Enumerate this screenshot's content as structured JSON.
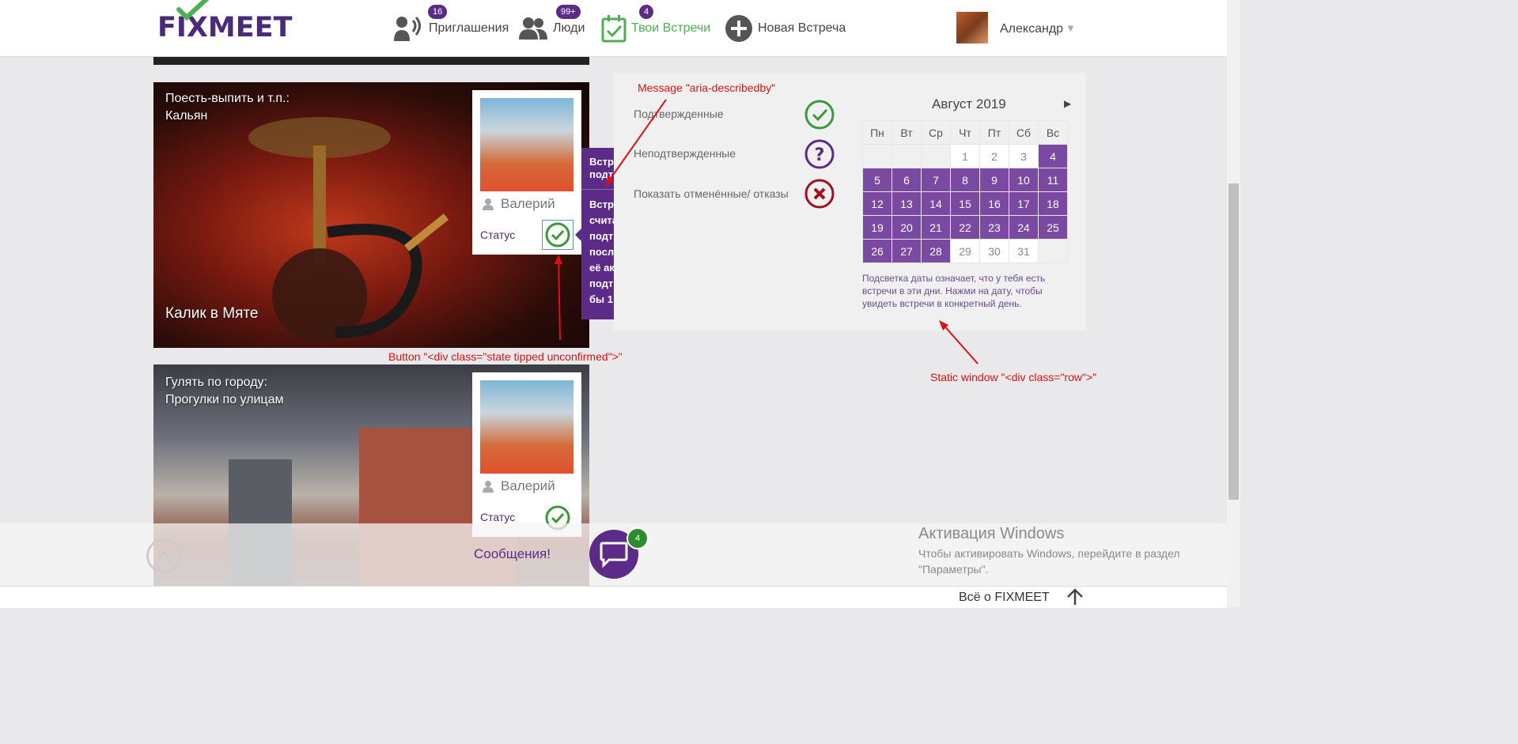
{
  "brand": {
    "logo": "FIXMEET",
    "accent": "#5b2b87"
  },
  "nav": {
    "invitations": {
      "label": "Приглашения",
      "badge": "16"
    },
    "people": {
      "label": "Люди",
      "badge": "99+"
    },
    "my_meetings": {
      "label": "Твои Встречи",
      "badge": "4"
    },
    "new_meeting": {
      "label": "Новая Встреча"
    }
  },
  "user": {
    "name": "Александр"
  },
  "cards": [
    {
      "category": "Поесть-выпить и т.п.:",
      "subcategory": "Кальян",
      "name": "Калик в Мяте",
      "person": "Валерий",
      "status_label": "Статус"
    },
    {
      "category": "Гулять по городу:",
      "subcategory": "Прогулки по улицам",
      "person": "Валерий",
      "status_label": "Статус"
    }
  ],
  "tooltip": {
    "head": "Встр подт",
    "body": "Встр счита подт посл её ак подт бы 1"
  },
  "legend": {
    "confirmed": "Подтвержденные",
    "unconfirmed": "Неподтвержденные",
    "cancelled": "Показать отменённые/ отказы"
  },
  "calendar": {
    "month": "Август 2019",
    "weekdays": [
      "Пн",
      "Вт",
      "Ср",
      "Чт",
      "Пт",
      "Сб",
      "Вс"
    ],
    "weeks": [
      [
        "",
        "",
        "",
        "1",
        "2",
        "3",
        "4"
      ],
      [
        "5",
        "6",
        "7",
        "8",
        "9",
        "10",
        "11"
      ],
      [
        "12",
        "13",
        "14",
        "15",
        "16",
        "17",
        "18"
      ],
      [
        "19",
        "20",
        "21",
        "22",
        "23",
        "24",
        "25"
      ],
      [
        "26",
        "27",
        "28",
        "29",
        "30",
        "31",
        ""
      ]
    ],
    "event_days": [
      "4",
      "5",
      "6",
      "7",
      "8",
      "9",
      "10",
      "11",
      "12",
      "13",
      "14",
      "15",
      "16",
      "17",
      "18",
      "19",
      "20",
      "21",
      "22",
      "23",
      "24",
      "25",
      "26",
      "27",
      "28"
    ],
    "note": "Подсветка даты означает, что у тебя есть встречи в эти дни. Нажми на дату, чтобы увидеть встречи в конкретный день."
  },
  "annotations": {
    "message": "Message \"aria-describedby\"",
    "button": "Button \"<div class=\"state tipped unconfirmed\">\"",
    "static": "Static window \"<div class=\"row\">\""
  },
  "messages": {
    "label": "Сообщения!",
    "badge": "4"
  },
  "windows_activation": {
    "title": "Активация Windows",
    "subtitle": "Чтобы активировать Windows, перейдите в раздел \"Параметры\"."
  },
  "footer": {
    "link": "Всё о FIXMEET"
  }
}
